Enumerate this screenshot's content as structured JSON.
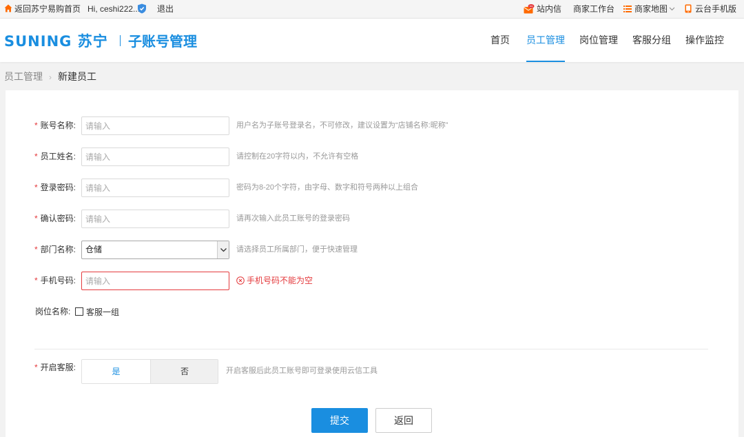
{
  "topbar": {
    "home_link": "返回苏宁易购首页",
    "greeting": "Hi, ceshi222...",
    "logout": "退出",
    "messages": "站内信",
    "workbench": "商家工作台",
    "merchant_map": "商家地图",
    "mobile_app": "云台手机版"
  },
  "header": {
    "logo_brand": "SUNING 苏宁",
    "logo_title": "子账号管理",
    "nav": [
      {
        "label": "首页",
        "active": false
      },
      {
        "label": "员工管理",
        "active": true
      },
      {
        "label": "岗位管理",
        "active": false
      },
      {
        "label": "客服分组",
        "active": false
      },
      {
        "label": "操作监控",
        "active": false
      }
    ]
  },
  "breadcrumb": {
    "parent": "员工管理",
    "current": "新建员工"
  },
  "form": {
    "account_name": {
      "label": "账号名称:",
      "placeholder": "请输入",
      "hint": "用户名为子账号登录名，不可修改，建议设置为“店铺名称:昵称”"
    },
    "employee_name": {
      "label": "员工姓名:",
      "placeholder": "请输入",
      "hint": "请控制在20字符以内，不允许有空格"
    },
    "password": {
      "label": "登录密码:",
      "placeholder": "请输入",
      "hint": "密码为8-20个字符，由字母、数字和符号两种以上组合"
    },
    "confirm_password": {
      "label": "确认密码:",
      "placeholder": "请输入",
      "hint": "请再次输入此员工账号的登录密码"
    },
    "department": {
      "label": "部门名称:",
      "value": "仓储",
      "hint": "请选择员工所属部门，便于快速管理"
    },
    "phone": {
      "label": "手机号码:",
      "placeholder": "请输入",
      "error": "手机号码不能为空"
    },
    "position": {
      "label": "岗位名称:",
      "option": "客服一组"
    },
    "customer_service": {
      "label": "开启客服:",
      "yes": "是",
      "no": "否",
      "selected": "是",
      "hint": "开启客服后此员工账号即可登录使用云信工具"
    },
    "required_mark": "*"
  },
  "actions": {
    "submit": "提交",
    "back": "返回"
  },
  "colors": {
    "accent": "#1a8ee0",
    "error": "#e4393c",
    "top_icon": "#ff6a00"
  }
}
